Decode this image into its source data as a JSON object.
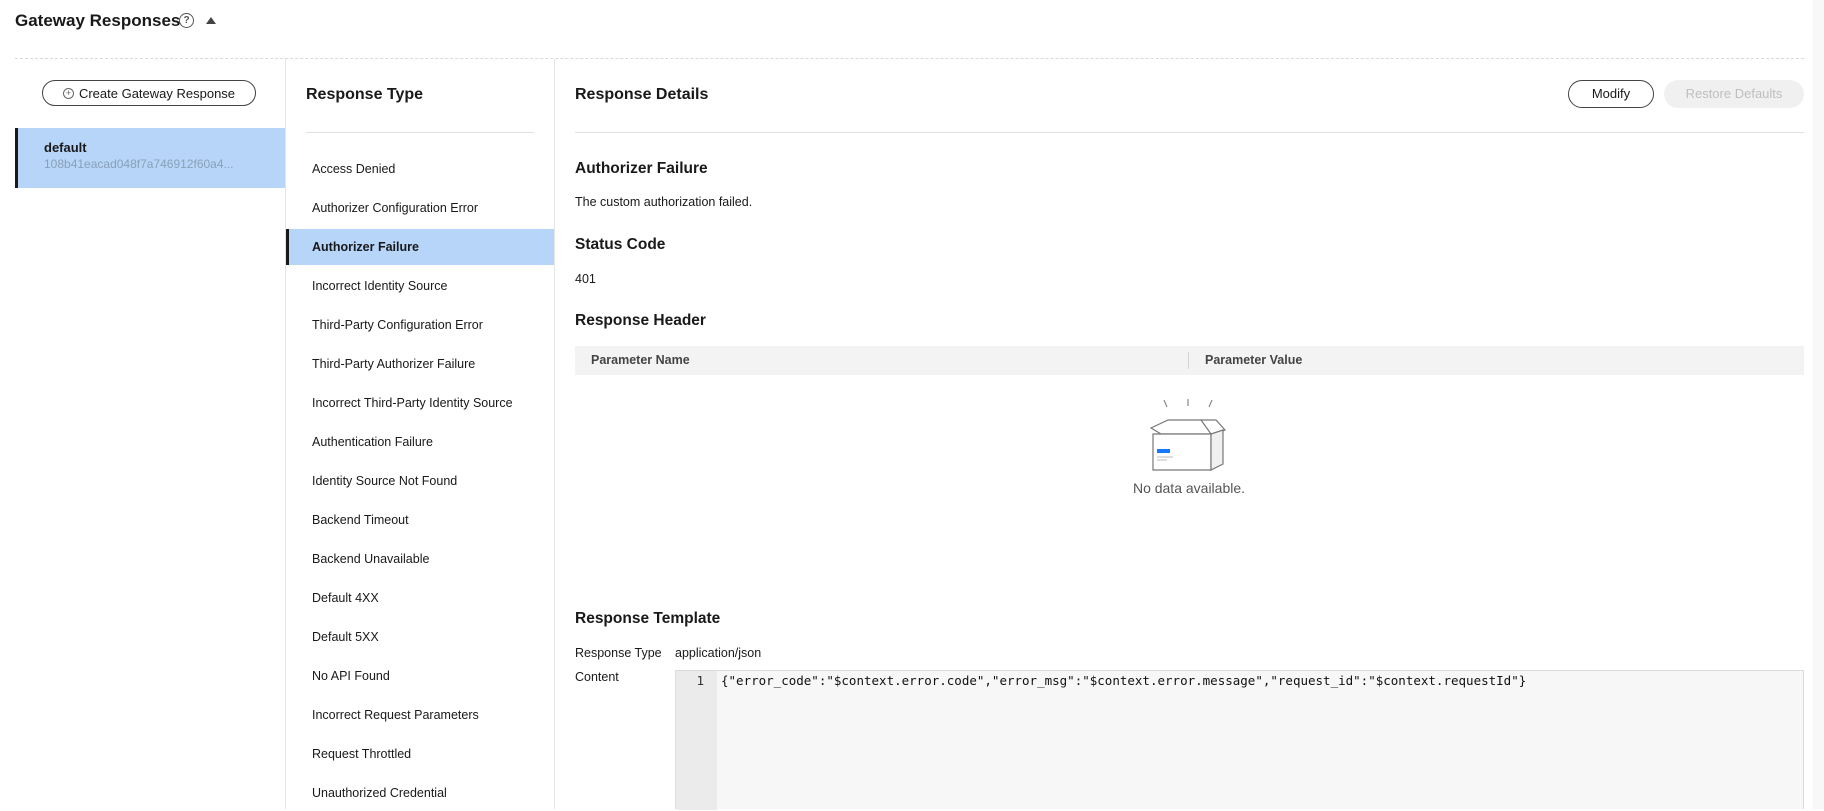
{
  "header": {
    "title": "Gateway Responses",
    "help_icon": "question-circle-icon",
    "collapse_icon": "caret-up-icon"
  },
  "left": {
    "create_button_label": "Create Gateway Response",
    "create_button_icon": "plus-circle-icon",
    "gateway_items": [
      {
        "name": "default",
        "id": "108b41eacad048f7a746912f60a4..."
      }
    ]
  },
  "middle": {
    "header": "Response Type",
    "items": [
      "Access Denied",
      "Authorizer Configuration Error",
      "Authorizer Failure",
      "Incorrect Identity Source",
      "Third-Party Configuration Error",
      "Third-Party Authorizer Failure",
      "Incorrect Third-Party Identity Source",
      "Authentication Failure",
      "Identity Source Not Found",
      "Backend Timeout",
      "Backend Unavailable",
      "Default 4XX",
      "Default 5XX",
      "No API Found",
      "Incorrect Request Parameters",
      "Request Throttled",
      "Unauthorized Credential"
    ],
    "selected_index": 2
  },
  "details": {
    "header": "Response Details",
    "modify_label": "Modify",
    "restore_label": "Restore Defaults",
    "selected_title": "Authorizer Failure",
    "selected_description": "The custom authorization failed.",
    "status_code_title": "Status Code",
    "status_code": "401",
    "response_header_title": "Response Header",
    "table_columns": [
      "Parameter Name",
      "Parameter Value"
    ],
    "empty_text": "No data available.",
    "empty_icon": "empty-box-icon",
    "template_title": "Response Template",
    "template_type_label": "Response Type",
    "template_type_value": "application/json",
    "template_content_label": "Content",
    "code_line_number": "1",
    "code": "{\"error_code\":\"$context.error.code\",\"error_msg\":\"$context.error.message\",\"request_id\":\"$context.requestId\"}"
  },
  "colors": {
    "selection_bg": "#b6d5f8",
    "accent_blue": "#1677ff",
    "disabled_text": "#bfbfbf"
  }
}
